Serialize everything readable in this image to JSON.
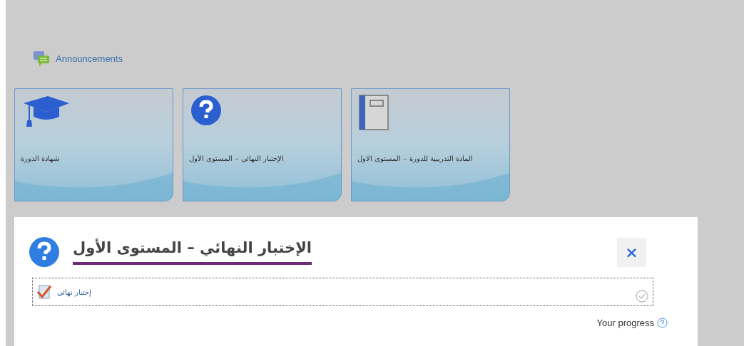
{
  "announcements": {
    "label": "Announcements"
  },
  "cards": [
    {
      "kind": "book",
      "title": "المادة التدريبية للدورة – المستوى الاول"
    },
    {
      "kind": "quiz",
      "title": "الإختبار النهائي – المستوى الأول"
    },
    {
      "kind": "certificate",
      "title": "شهادة الدورة"
    }
  ],
  "panel": {
    "title": "الإختبار النهائي – المستوى الأول",
    "close": "×",
    "activities": [
      {
        "label": "إختبار نهائي",
        "completed": false
      }
    ],
    "progress_label": "Your progress"
  }
}
